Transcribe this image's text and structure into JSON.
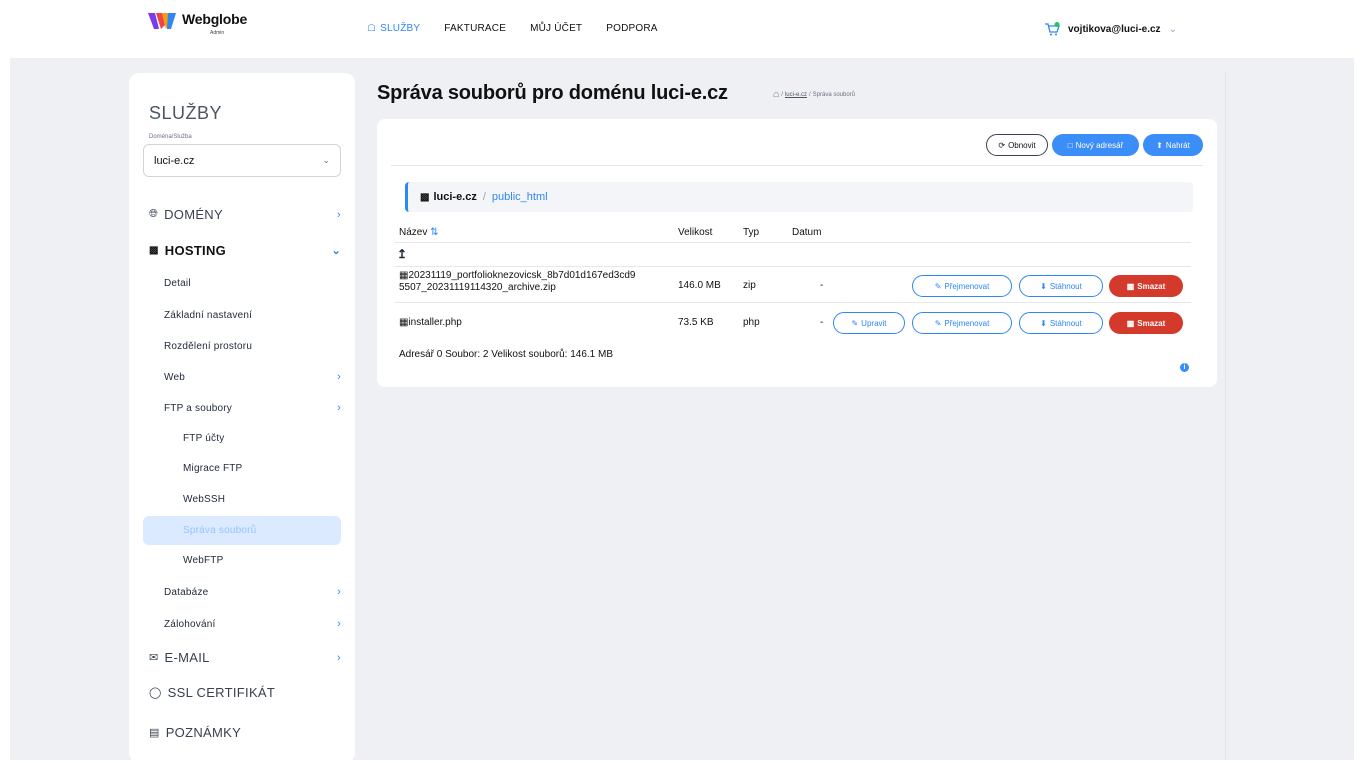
{
  "brand": {
    "name": "Webglobe",
    "sub": "Admin"
  },
  "nav": [
    {
      "label": "SLUŽBY",
      "icon": "home-icon",
      "active": true
    },
    {
      "label": "FAKTURACE"
    },
    {
      "label": "MŮJ ÚČET"
    },
    {
      "label": "PODPORA"
    }
  ],
  "user": {
    "email": "vojtikova@luci-e.cz"
  },
  "sidebar": {
    "title": "SLUŽBY",
    "select_label": "Doména/Služba",
    "select_value": "luci-e.cz",
    "items": [
      {
        "label": "DOMÉNY"
      },
      {
        "label": "HOSTING"
      },
      {
        "label": "Detail"
      },
      {
        "label": "Základní nastavení"
      },
      {
        "label": "Rozdělení prostoru"
      },
      {
        "label": "Web"
      },
      {
        "label": "FTP a soubory"
      },
      {
        "label": "FTP účty"
      },
      {
        "label": "Migrace FTP"
      },
      {
        "label": "WebSSH"
      },
      {
        "label": "Správa souborů"
      },
      {
        "label": "WebFTP"
      },
      {
        "label": "Databáze"
      },
      {
        "label": "Zálohování"
      },
      {
        "label": "E-MAIL"
      },
      {
        "label": "SSL CERTIFIKÁT"
      },
      {
        "label": "POZNÁMKY"
      }
    ]
  },
  "page": {
    "title": "Správa souborů pro doménu luci-e.cz",
    "breadcrumb": {
      "link": "luci-e.cz",
      "sep1": "/",
      "sep2": "/",
      "current": "Správa souborů"
    }
  },
  "toolbar": {
    "refresh": "Obnovit",
    "new_dir": "Nový adresář",
    "upload": "Nahrát"
  },
  "path": {
    "root": "luci-e.cz",
    "sep": "/",
    "current": "public_html"
  },
  "table": {
    "headers": {
      "name": "Název",
      "size": "Velikost",
      "type": "Typ",
      "date": "Datum"
    },
    "up": "↥",
    "rows": [
      {
        "name_line1": "20231119_portfolioknezovicsk_8b7d01d167ed3cd9",
        "name_line2": "5507_20231119114320_archive.zip",
        "size": "146.0 MB",
        "type": "zip",
        "date": "-"
      },
      {
        "name_line1": "installer.php",
        "size": "73.5 KB",
        "type": "php",
        "date": "-"
      }
    ],
    "actions": {
      "edit": "Upravit",
      "rename": "Přejmenovat",
      "download": "Stáhnout",
      "delete": "Smazat"
    }
  },
  "summary": "Adresář 0 Soubor: 2 Velikost souborů: 146.1 MB",
  "colors": {
    "accent": "#2f86f6",
    "danger": "#d33a2c",
    "background": "#eef0f3"
  }
}
